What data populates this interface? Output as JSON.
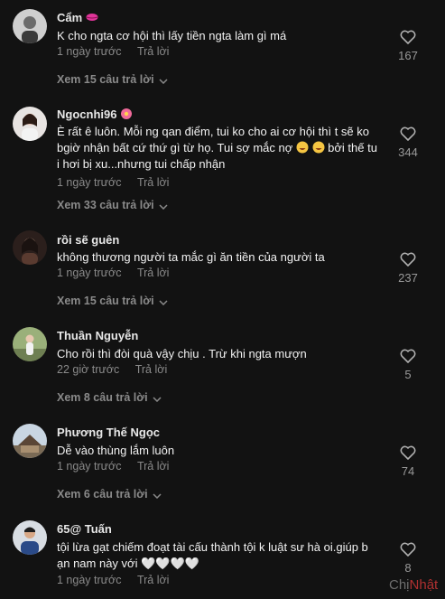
{
  "comments": [
    {
      "name": "Cẩm",
      "name_suffix_icon": "lips-icon",
      "text": "K cho ngta cơ hội thì lấy tiền ngta làm gì má",
      "time": "1 ngày trước",
      "reply": "Trả lời",
      "view_replies": "Xem 15 câu trả lời",
      "likes": "167"
    },
    {
      "name": "Ngocnhi96",
      "name_suffix_icon": "flower-icon",
      "text_line1": "È rất ê luôn. Mỗi ng qan điểm, tui ko cho ai cơ hội thì t sẽ ko",
      "text_line2a": "bgiờ nhận bất cứ thứ gì từ họ. Tui sợ mắc nợ",
      "text_line2b": "bởi thế tu",
      "text_line3": "i hơi bị xu...nhưng tui chấp nhận",
      "time": "1 ngày trước",
      "reply": "Trả lời",
      "view_replies": "Xem 33 câu trả lời",
      "likes": "344"
    },
    {
      "name": "rồi sẽ guên",
      "text": "không thương người ta mắc gì ăn tiền của người ta",
      "time": "1 ngày trước",
      "reply": "Trả lời",
      "view_replies": "Xem 15 câu trả lời",
      "likes": "237"
    },
    {
      "name": "Thuần Nguyễn",
      "text": "Cho rồi thì đòi quà vậy chịu . Trừ khi ngta mượn",
      "time": "22 giờ trước",
      "reply": "Trả lời",
      "view_replies": "Xem 8 câu trả lời",
      "likes": "5"
    },
    {
      "name": "Phương Thế Ngọc",
      "text": "Dễ vào thùng lắm luôn",
      "time": "1 ngày trước",
      "reply": "Trả lời",
      "view_replies": "Xem 6 câu trả lời",
      "likes": "74"
    },
    {
      "name": "65@ Tuấn",
      "text_line1": "tội lừa gạt chiếm đoạt tài cấu thành tội k luật sư hà oi.giúp b",
      "text_line2": "ạn nam này với 🤍🤍🤍🤍",
      "time": "1 ngày trước",
      "reply": "Trả lời",
      "likes": "8"
    }
  ],
  "watermark": {
    "part1": "Chị",
    "part2": "Nhật"
  },
  "colors": {
    "background": "#121212",
    "muted": "#8a8a8a",
    "like_outline": "#b0b0b0"
  }
}
